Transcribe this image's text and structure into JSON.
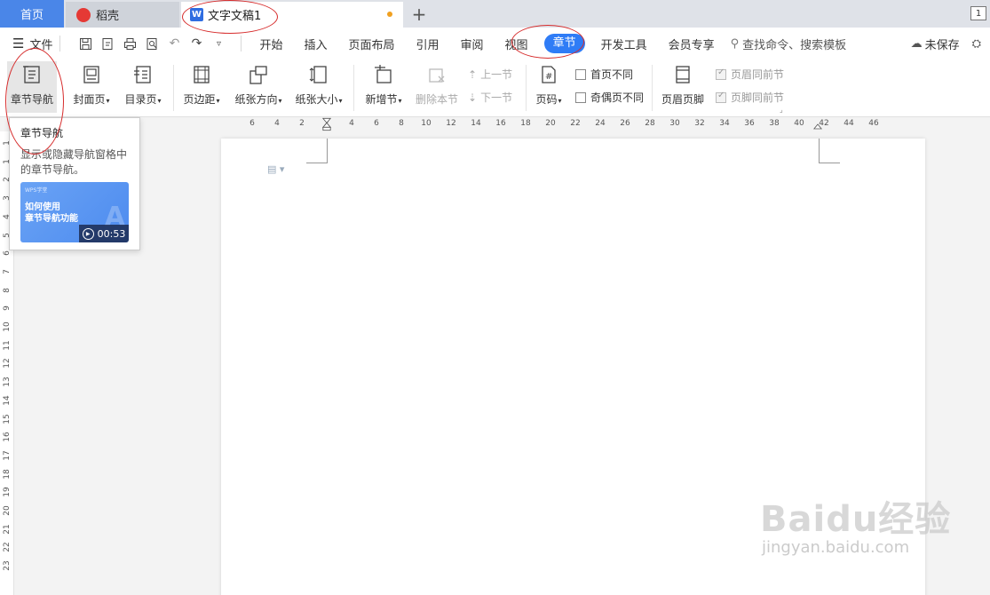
{
  "tabs": {
    "home": "首页",
    "daoke": "稻壳",
    "document": "文字文稿1",
    "add": "+",
    "page_indicator": "1"
  },
  "menubar": {
    "file": "文件",
    "items": [
      "开始",
      "插入",
      "页面布局",
      "引用",
      "审阅",
      "视图",
      "章节",
      "开发工具",
      "会员专享"
    ],
    "active_item": "章节",
    "search_placeholder": "查找命令、搜索模板",
    "save_status": "未保存"
  },
  "ribbon": {
    "chapter_nav": "章节导航",
    "cover_page": "封面页",
    "toc_page": "目录页",
    "margins": "页边距",
    "orientation": "纸张方向",
    "paper_size": "纸张大小",
    "new_section": "新增节",
    "delete_section": "删除本节",
    "prev_section": "上一节",
    "next_section": "下一节",
    "page_number": "页码",
    "first_page_diff": "首页不同",
    "odd_even_diff": "奇偶页不同",
    "header_footer": "页眉页脚",
    "header_same_as_prev": "页眉同前节",
    "footer_same_as_prev": "页脚同前节"
  },
  "tooltip": {
    "title": "章节导航",
    "description": "显示或隐藏导航窗格中的章节导航。",
    "video_brand": "WPS学堂",
    "video_title_line1": "如何使用",
    "video_title_line2": "章节导航功能",
    "video_duration": "00:53"
  },
  "ruler": {
    "horizontal_ticks": [
      "6",
      "4",
      "2",
      "2",
      "4",
      "6",
      "8",
      "10",
      "12",
      "14",
      "16",
      "18",
      "20",
      "22",
      "24",
      "26",
      "28",
      "30",
      "32",
      "34",
      "36",
      "38",
      "40",
      "42",
      "44",
      "46"
    ],
    "vertical_ticks": [
      "1",
      "1",
      "2",
      "3",
      "4",
      "5",
      "6",
      "7",
      "8",
      "9",
      "10",
      "11",
      "12",
      "13",
      "14",
      "15",
      "16",
      "17",
      "18",
      "19",
      "20",
      "21",
      "22",
      "23"
    ]
  },
  "watermark": {
    "main": "Baidu经验",
    "url": "jingyan.baidu.com"
  },
  "colors": {
    "accent": "#2f7cf6",
    "home_tab": "#4a86e8",
    "annotation": "#d62b2b"
  }
}
